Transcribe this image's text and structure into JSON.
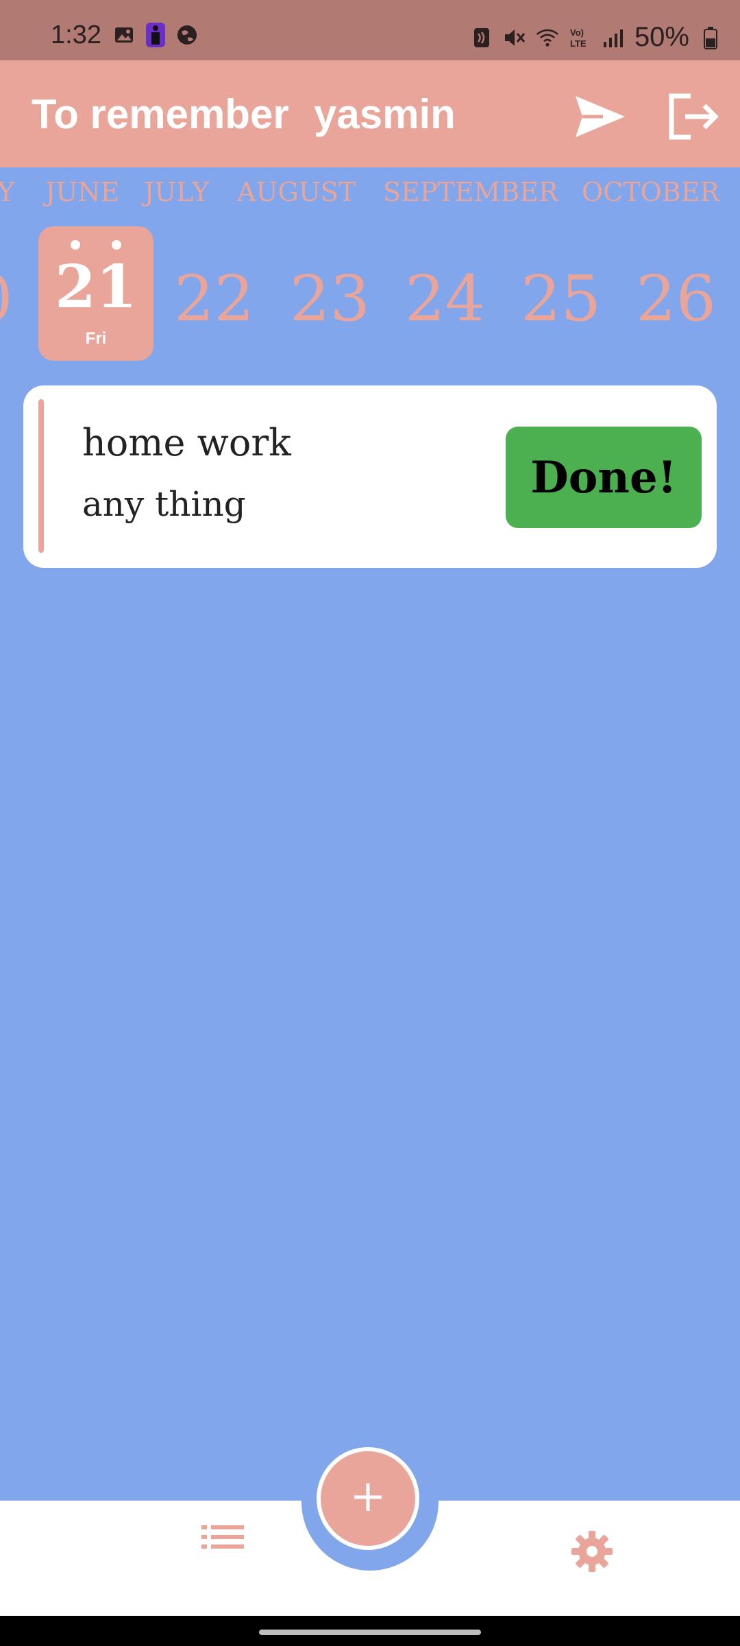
{
  "status_bar": {
    "time": "1:32",
    "battery": "50%",
    "icons_left": [
      "image-icon",
      "figure-app-icon",
      "globe-icon"
    ],
    "icons_right": [
      "nfc-icon",
      "mute-icon",
      "wifi-icon",
      "volte-icon",
      "signal-icon",
      "battery-icon"
    ]
  },
  "app_bar": {
    "title": "To remember",
    "user": "yasmin",
    "actions": [
      "send-icon",
      "logout-icon"
    ]
  },
  "months": [
    "Y",
    "JUNE",
    "JULY",
    "AUGUST",
    "SEPTEMBER",
    "OCTOBER"
  ],
  "days": {
    "partial": "0",
    "selected": {
      "number": "21",
      "weekday": "Fri"
    },
    "others": [
      "22",
      "23",
      "24",
      "25",
      "26"
    ]
  },
  "task": {
    "title": "home work",
    "description": "any thing",
    "done_label": "Done!"
  },
  "bottom_nav": {
    "fab_symbol": "+",
    "left_icon": "list-icon",
    "right_icon": "settings-icon"
  },
  "colors": {
    "accent": "#E9A59A",
    "background": "#81A6EC",
    "done_button": "#4CAF50",
    "status_bar": "#B17B74"
  }
}
